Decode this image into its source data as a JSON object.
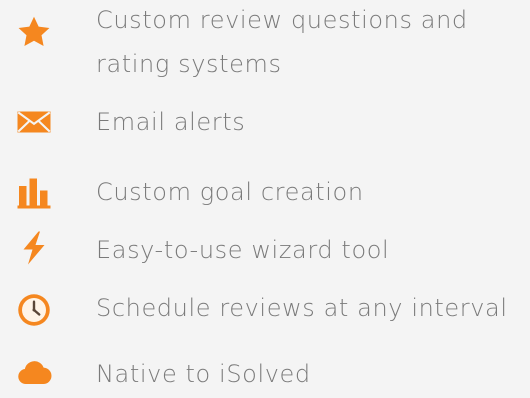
{
  "colors": {
    "background": "#f4f4f4",
    "text": "#7a7a7a",
    "accent": "#f5871f"
  },
  "features": [
    {
      "icon": "star-icon",
      "lines": [
        "Custom review questions and",
        "rating systems"
      ]
    },
    {
      "icon": "envelope-icon",
      "lines": [
        "Email alerts"
      ]
    },
    {
      "icon": "bar-chart-icon",
      "lines": [
        "Custom goal creation"
      ]
    },
    {
      "icon": "lightning-bolt-icon",
      "lines": [
        "Easy-to-use wizard tool"
      ]
    },
    {
      "icon": "clock-icon",
      "lines": [
        "Schedule reviews at any interval"
      ]
    },
    {
      "icon": "cloud-icon",
      "lines": [
        "Native to iSolved"
      ]
    }
  ]
}
